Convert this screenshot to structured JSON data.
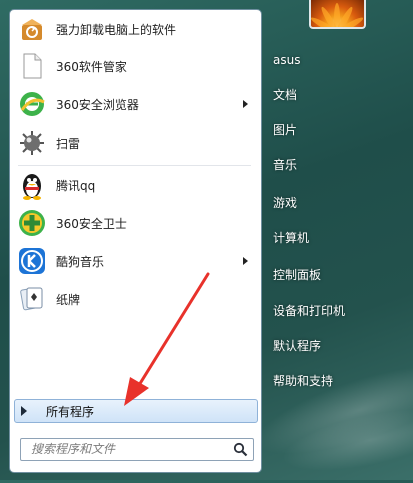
{
  "programs": [
    {
      "label": "强力卸载电脑上的软件",
      "icon": "uninstaller-box-icon",
      "has_submenu": false
    },
    {
      "label": "360软件管家",
      "icon": "blank-document-icon",
      "has_submenu": false
    },
    {
      "label": "360安全浏览器",
      "icon": "360-browser-icon",
      "has_submenu": true
    },
    {
      "label": "扫雷",
      "icon": "minesweeper-mine-icon",
      "has_submenu": false
    },
    {
      "label": "腾讯qq",
      "icon": "qq-penguin-icon",
      "has_submenu": false
    },
    {
      "label": "360安全卫士",
      "icon": "360-security-guard-icon",
      "has_submenu": false
    },
    {
      "label": "酷狗音乐",
      "icon": "kugou-music-icon",
      "has_submenu": true
    },
    {
      "label": "纸牌",
      "icon": "solitaire-cards-icon",
      "has_submenu": false
    }
  ],
  "all_programs": {
    "label": "所有程序"
  },
  "search": {
    "placeholder": "搜索程序和文件"
  },
  "right_pane": {
    "items": [
      {
        "label": "asus"
      },
      {
        "label": "文档"
      },
      {
        "label": "图片"
      },
      {
        "label": "音乐"
      },
      {
        "label": "游戏"
      },
      {
        "label": "计算机"
      },
      {
        "label": "控制面板"
      },
      {
        "label": "设备和打印机"
      },
      {
        "label": "默认程序"
      },
      {
        "label": "帮助和支持"
      }
    ]
  },
  "colors": {
    "annotation_arrow": "#e8322b",
    "all_programs_highlight": "#cfe3f8",
    "pane_background": "#ffffff",
    "right_text": "#ffffff"
  }
}
